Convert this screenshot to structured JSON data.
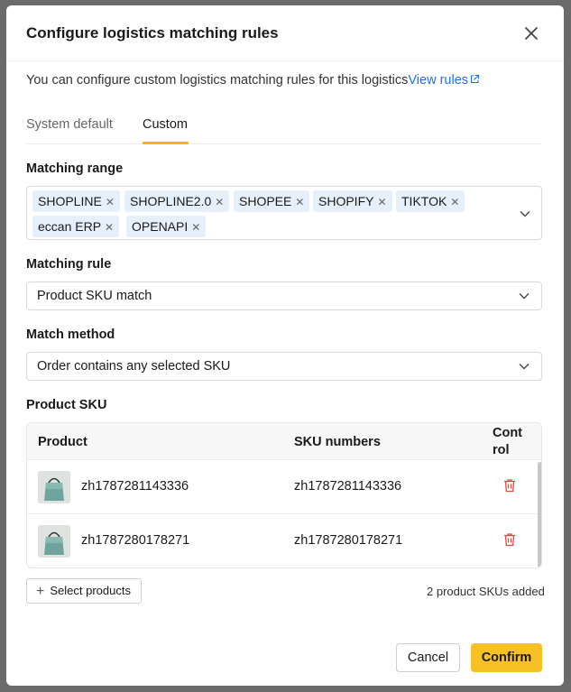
{
  "dialog": {
    "title": "Configure logistics matching rules",
    "description": "You can configure custom logistics matching rules for this logistics",
    "view_rules_link": "View rules",
    "tabs": [
      {
        "label": "System default",
        "active": false
      },
      {
        "label": "Custom",
        "active": true
      }
    ],
    "matching_range": {
      "label": "Matching range",
      "tags": [
        "SHOPLINE",
        "SHOPLINE2.0",
        "SHOPEE",
        "SHOPIFY",
        "TIKTOK",
        "eccan ERP",
        "OPENAPI"
      ]
    },
    "matching_rule": {
      "label": "Matching rule",
      "value": "Product SKU match"
    },
    "match_method": {
      "label": "Match method",
      "value": "Order contains any selected SKU"
    },
    "product_sku": {
      "label": "Product SKU",
      "columns": {
        "product": "Product",
        "sku": "SKU numbers",
        "control_line1": "Cont",
        "control_line2": "rol"
      },
      "rows": [
        {
          "product": "zh1787281143336",
          "sku": "zh1787281143336"
        },
        {
          "product": "zh1787280178271",
          "sku": "zh1787280178271"
        }
      ],
      "select_button": "Select products",
      "count_text": "2 product SKUs added"
    },
    "buttons": {
      "cancel": "Cancel",
      "confirm": "Confirm"
    }
  },
  "icons": {
    "close": "close-icon",
    "external_link": "external-link-icon",
    "chevron": "chevron-down-icon",
    "delete": "trash-icon",
    "plus": "plus-icon",
    "product_thumb": "product-thumbnail"
  },
  "colors": {
    "accent_yellow": "#f7c125",
    "tab_underline": "#f5b800",
    "link_blue": "#1f6feb",
    "tag_bg": "#e6f0fb",
    "delete_red": "#e5483f"
  }
}
